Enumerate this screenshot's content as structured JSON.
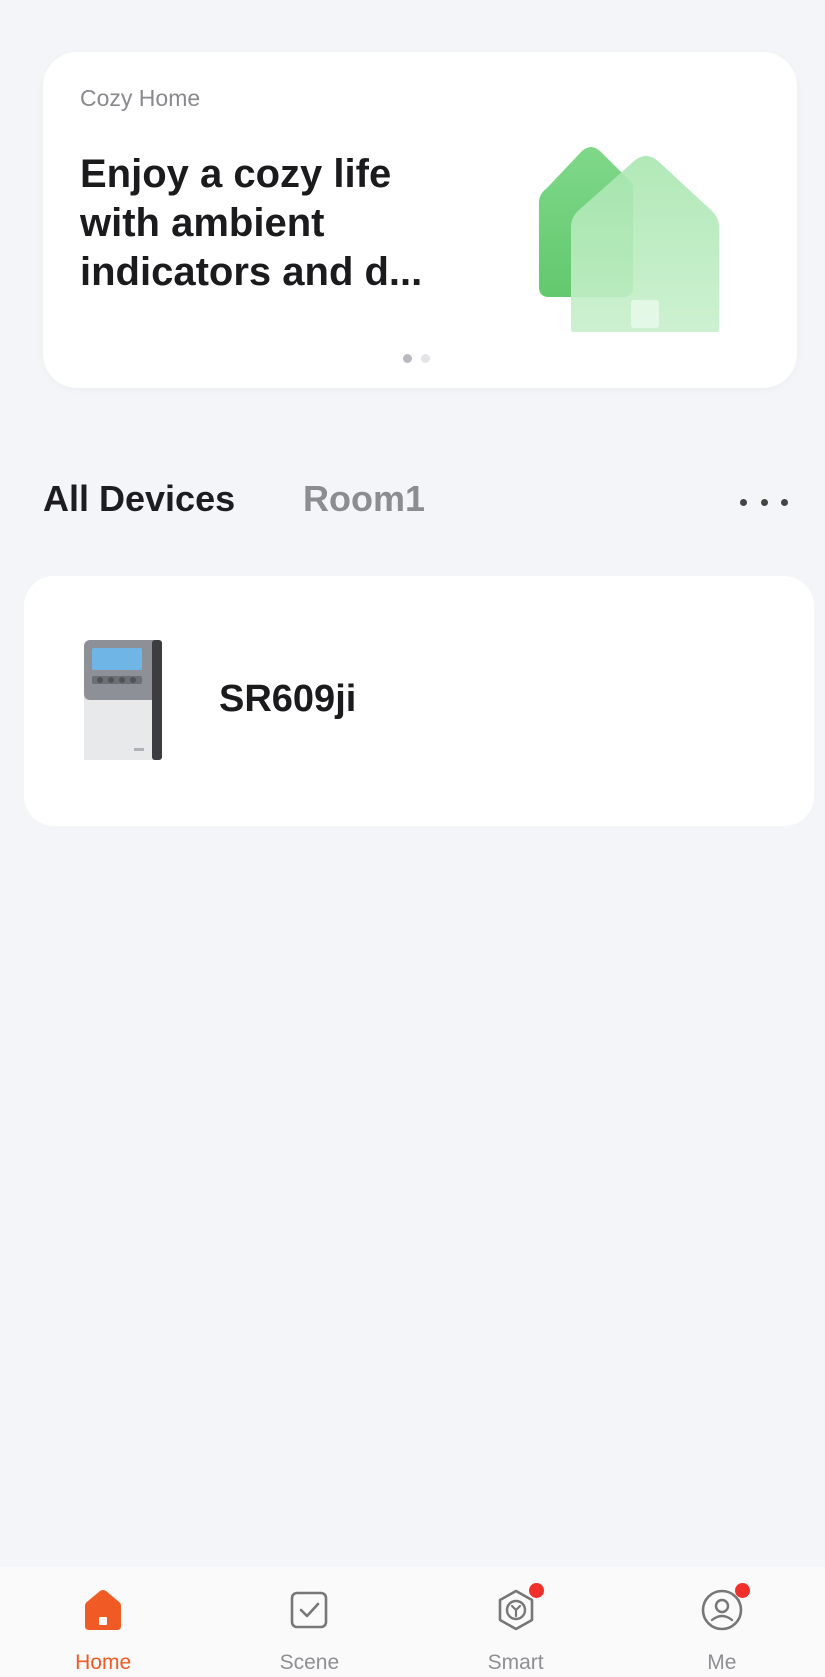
{
  "banner": {
    "tag": "Cozy Home",
    "title": "Enjoy a cozy life with ambient indicators and d...",
    "pages": 2,
    "active_page": 1,
    "illustration_icon": "green-houses-icon"
  },
  "tabs": [
    {
      "label": "All Devices",
      "active": true
    },
    {
      "label": "Room1",
      "active": false
    }
  ],
  "more_icon": "more-dots-icon",
  "devices": [
    {
      "name": "SR609ji",
      "icon": "solar-controller-device-image"
    }
  ],
  "bottom_nav": [
    {
      "label": "Home",
      "icon": "home-icon",
      "active": true,
      "badge": false
    },
    {
      "label": "Scene",
      "icon": "scene-check-icon",
      "active": false,
      "badge": false
    },
    {
      "label": "Smart",
      "icon": "smart-hex-icon",
      "active": false,
      "badge": true
    },
    {
      "label": "Me",
      "icon": "profile-icon",
      "active": false,
      "badge": true
    }
  ],
  "colors": {
    "accent": "#f05a24",
    "badge": "#f2302b",
    "background": "#f4f5f9",
    "house_green": "#6fd07a"
  }
}
